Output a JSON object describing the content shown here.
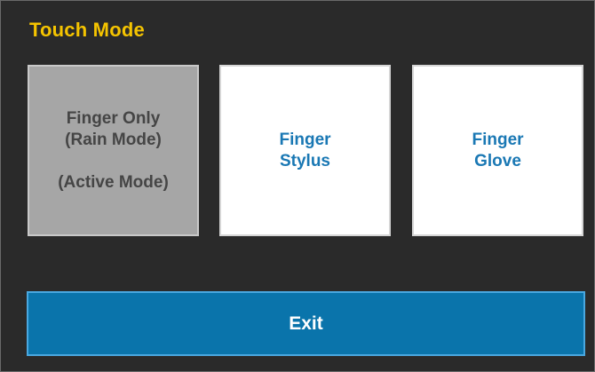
{
  "dialog": {
    "title": "Touch Mode",
    "colors": {
      "background": "#2a2a2a",
      "title": "#f5c400",
      "active_button": "#a6a6a6",
      "inactive_button_text": "#1a78b4",
      "exit_button": "#0a74ab"
    }
  },
  "modes": [
    {
      "line1": "Finger Only",
      "line2": "(Rain Mode)",
      "status": "(Active Mode)",
      "active": true
    },
    {
      "line1": "Finger",
      "line2": "Stylus",
      "active": false
    },
    {
      "line1": "Finger",
      "line2": "Glove",
      "active": false
    }
  ],
  "exit": {
    "label": "Exit"
  }
}
